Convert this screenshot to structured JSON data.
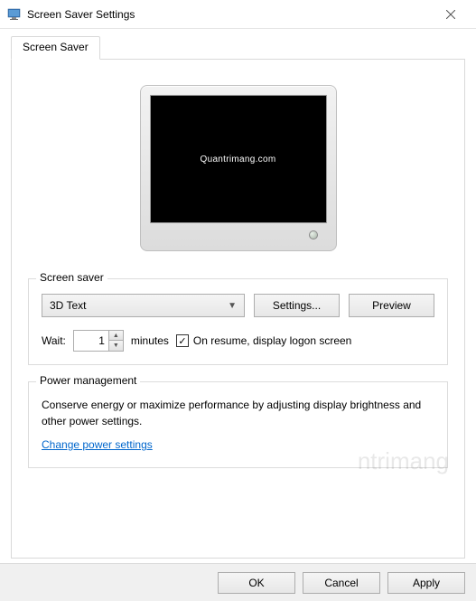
{
  "window": {
    "title": "Screen Saver Settings"
  },
  "tab": {
    "label": "Screen Saver"
  },
  "preview": {
    "screen_text": "Quantrimang.com"
  },
  "screensaver_group": {
    "legend": "Screen saver",
    "selected": "3D Text",
    "settings_btn": "Settings...",
    "preview_btn": "Preview",
    "wait_label": "Wait:",
    "wait_value": "1",
    "minutes_label": "minutes",
    "resume_checked": true,
    "resume_label": "On resume, display logon screen"
  },
  "power_group": {
    "legend": "Power management",
    "description": "Conserve energy or maximize performance by adjusting display brightness and other power settings.",
    "link": "Change power settings"
  },
  "footer": {
    "ok": "OK",
    "cancel": "Cancel",
    "apply": "Apply"
  },
  "watermark": "ntrimang"
}
